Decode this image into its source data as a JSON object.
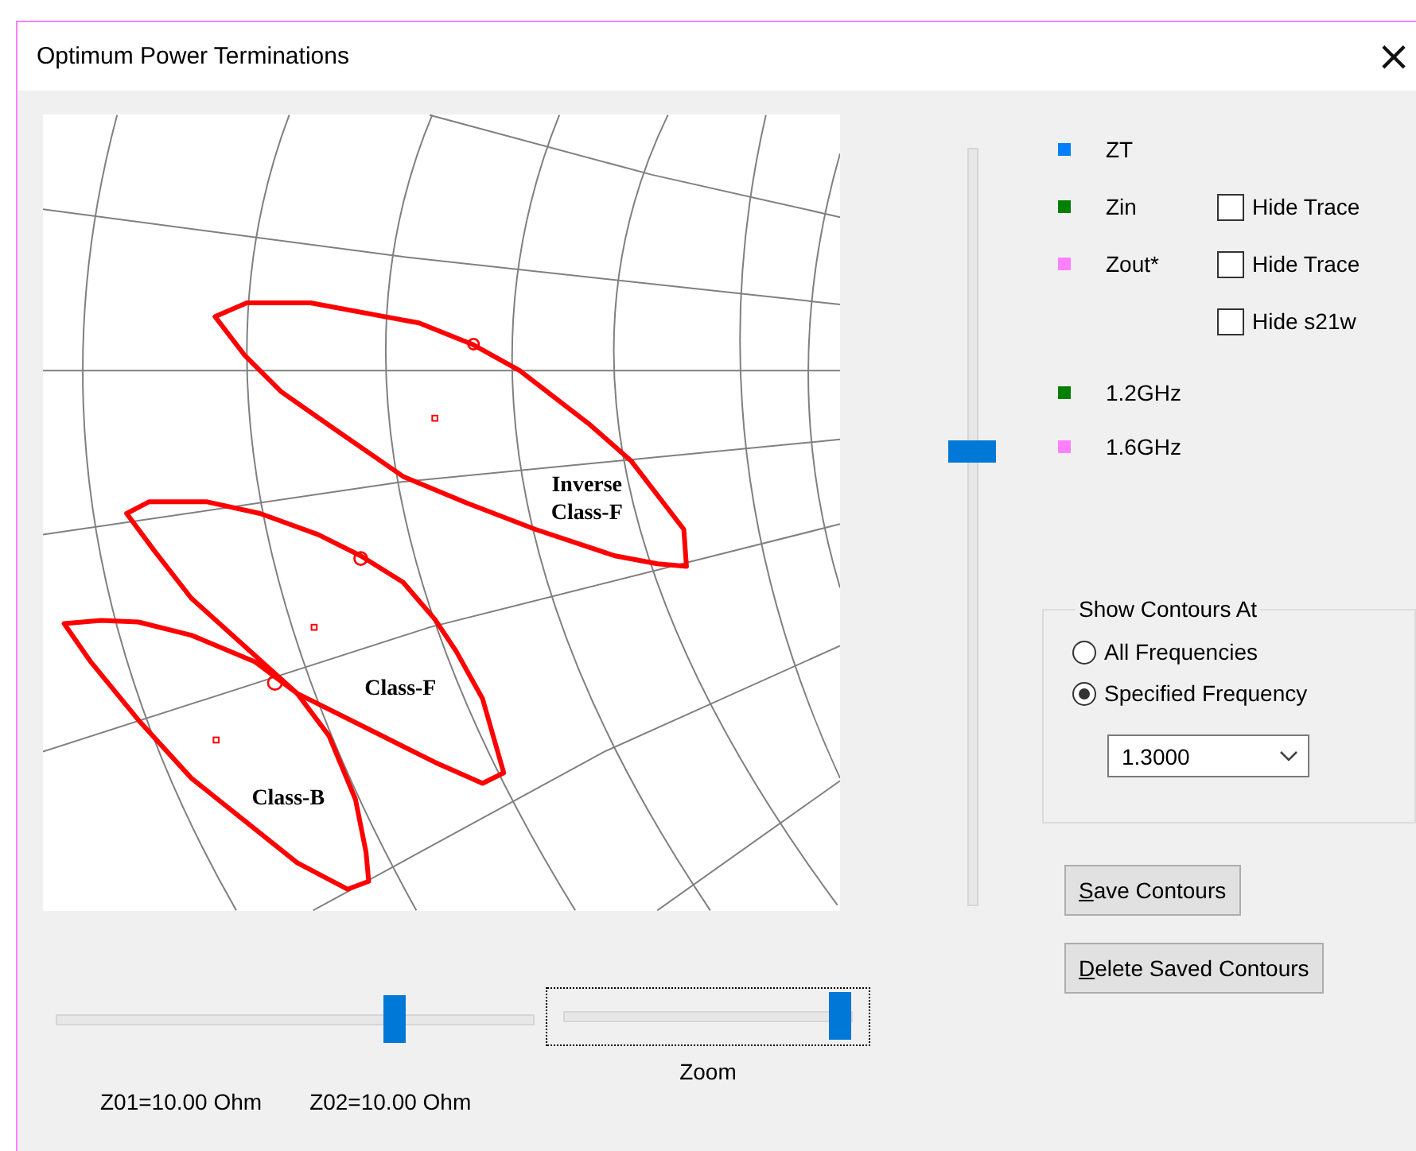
{
  "window": {
    "title": "Optimum Power Terminations",
    "close_glyph": "×"
  },
  "plot": {
    "contour_labels": [
      {
        "lines": [
          "Inverse",
          "Class-F"
        ]
      },
      {
        "lines": [
          "Class-F"
        ]
      },
      {
        "lines": [
          "Class-B"
        ]
      }
    ]
  },
  "legend": [
    {
      "label": "ZT",
      "color": "#0080ff"
    },
    {
      "label": "Zin",
      "color": "#008000",
      "checkbox": {
        "label": "Hide Trace",
        "checked": false
      }
    },
    {
      "label": "Zout*",
      "color": "#ff80ff",
      "checkbox": {
        "label": "Hide Trace",
        "checked": false
      }
    }
  ],
  "extra_checkbox": {
    "label": "Hide s21w",
    "checked": false
  },
  "frequencies": [
    {
      "label": "1.2GHz",
      "color": "#008000"
    },
    {
      "label": "1.6GHz",
      "color": "#ff80ff"
    }
  ],
  "contours_group": {
    "title": "Show Contours At",
    "options": [
      {
        "label": "All Frequencies",
        "selected": false
      },
      {
        "label": "Specified Frequency",
        "selected": true
      }
    ],
    "dropdown": {
      "value": "1.3000"
    }
  },
  "buttons": [
    "Save Contours",
    "Delete Saved Contours"
  ],
  "impedance_slider": {
    "level": 0.71,
    "labels": [
      "Z01=10.00 Ohm",
      "Z02=10.00 Ohm"
    ]
  },
  "zoom_slider": {
    "level": 0.96,
    "focused": true,
    "label": "Zoom"
  }
}
